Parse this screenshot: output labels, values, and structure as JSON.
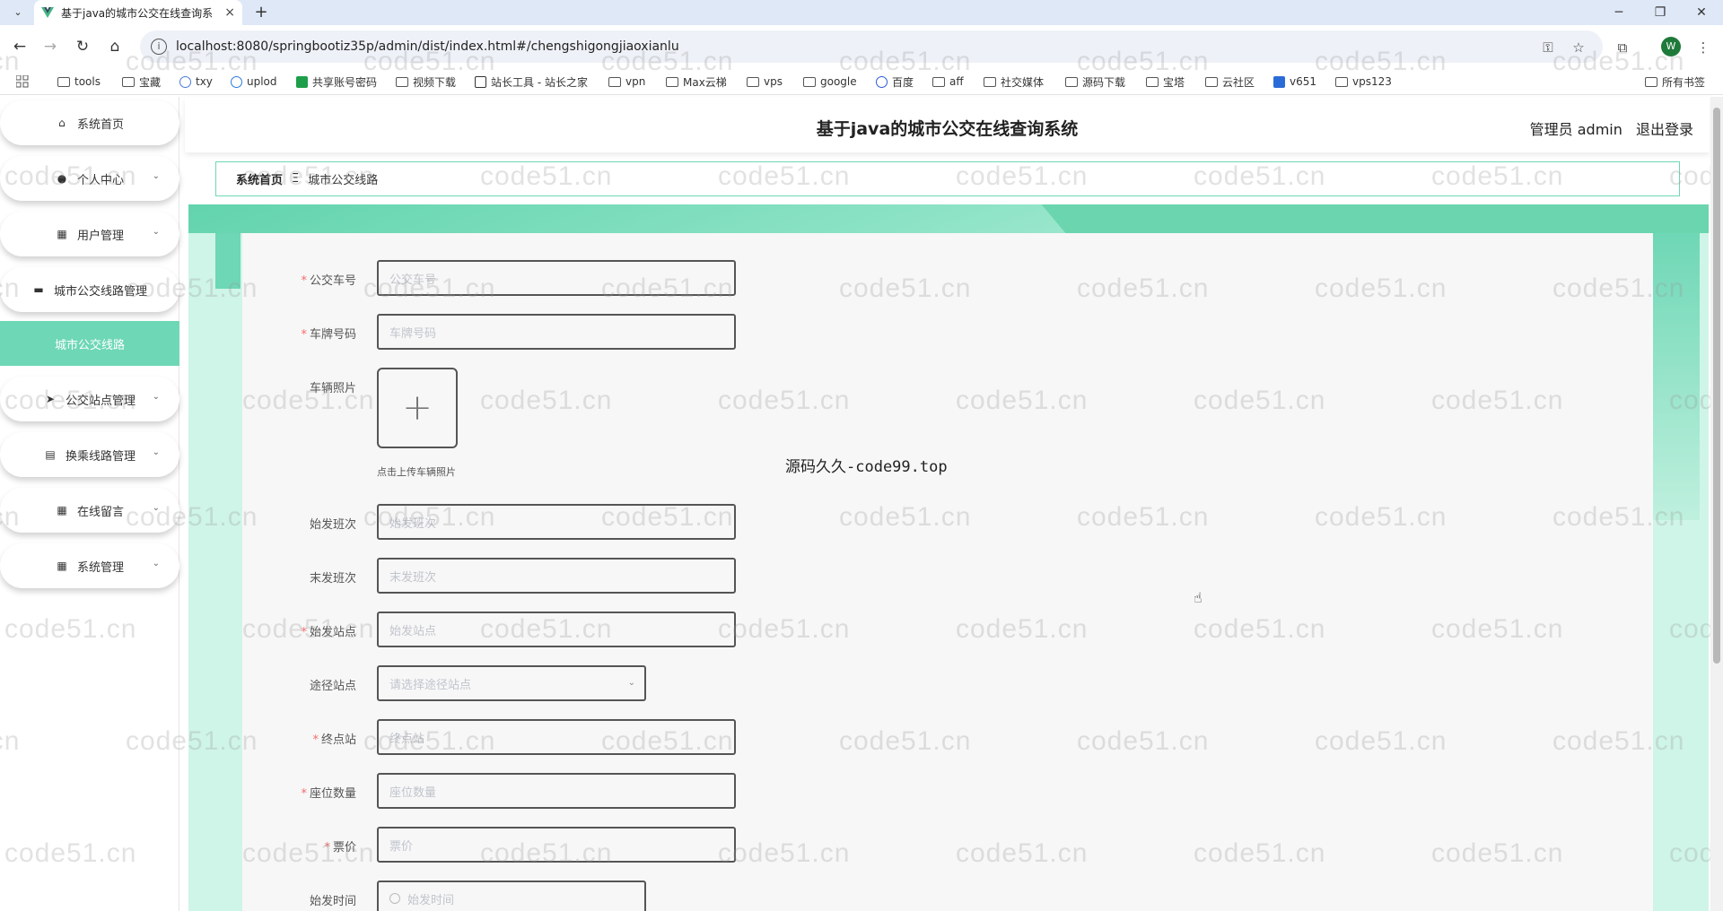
{
  "browser": {
    "tab_title": "基于java的城市公交在线查询系",
    "tab_close": "×",
    "new_tab": "+",
    "url": "localhost:8080/springbootiz35p/admin/dist/index.html#/chengshigongjiaoxianlu",
    "profile_initial": "W",
    "bookmarks": [
      "tools",
      "宝藏",
      "txy",
      "uplod",
      "共享账号密码",
      "视频下载",
      "站长工具 - 站长之家",
      "vpn",
      "Max云梯",
      "vps",
      "google",
      "百度",
      "aff",
      "社交媒体",
      "源码下载",
      "宝塔",
      "云社区",
      "v651",
      "vps123"
    ],
    "all_bookmarks": "所有书签"
  },
  "header": {
    "title": "基于java的城市公交在线查询系统",
    "user": "管理员 admin",
    "logout": "退出登录"
  },
  "sidebar": {
    "items": [
      {
        "label": "系统首页",
        "icon": "home-icon"
      },
      {
        "label": "个人中心",
        "icon": "user-icon"
      },
      {
        "label": "用户管理",
        "icon": "grid-icon"
      },
      {
        "label": "城市公交线路管理",
        "icon": "briefcase-icon"
      },
      {
        "label": "城市公交线路",
        "icon": ""
      },
      {
        "label": "公交站点管理",
        "icon": "send-icon"
      },
      {
        "label": "换乘线路管理",
        "icon": "clipboard-icon"
      },
      {
        "label": "在线留言",
        "icon": "grid-icon"
      },
      {
        "label": "系统管理",
        "icon": "grid-icon"
      }
    ]
  },
  "breadcrumb": {
    "home": "系统首页",
    "separator": "Ξ",
    "current": "城市公交线路"
  },
  "form": {
    "bus_no": {
      "label": "公交车号",
      "placeholder": "公交车号",
      "required": true
    },
    "plate": {
      "label": "车牌号码",
      "placeholder": "车牌号码",
      "required": true
    },
    "photo": {
      "label": "车辆照片",
      "hint": "点击上传车辆照片"
    },
    "first_shift": {
      "label": "始发班次",
      "placeholder": "始发班次",
      "required": false
    },
    "last_shift": {
      "label": "末发班次",
      "placeholder": "末发班次",
      "required": false
    },
    "start_station": {
      "label": "始发站点",
      "placeholder": "始发站点",
      "required": true
    },
    "via_stations": {
      "label": "途径站点",
      "placeholder": "请选择途径站点",
      "required": false
    },
    "terminal": {
      "label": "终点站",
      "placeholder": "终点站",
      "required": true
    },
    "seats": {
      "label": "座位数量",
      "placeholder": "座位数量",
      "required": true
    },
    "fare": {
      "label": "票价",
      "placeholder": "票价",
      "required": true
    },
    "start_time": {
      "label": "始发时间",
      "placeholder": "始发时间",
      "required": false
    }
  },
  "overlay_text": "源码久久-code99.top",
  "watermark_text": "code51.cn",
  "colors": {
    "accent": "#6ed7b5",
    "required": "#f56c6c"
  }
}
